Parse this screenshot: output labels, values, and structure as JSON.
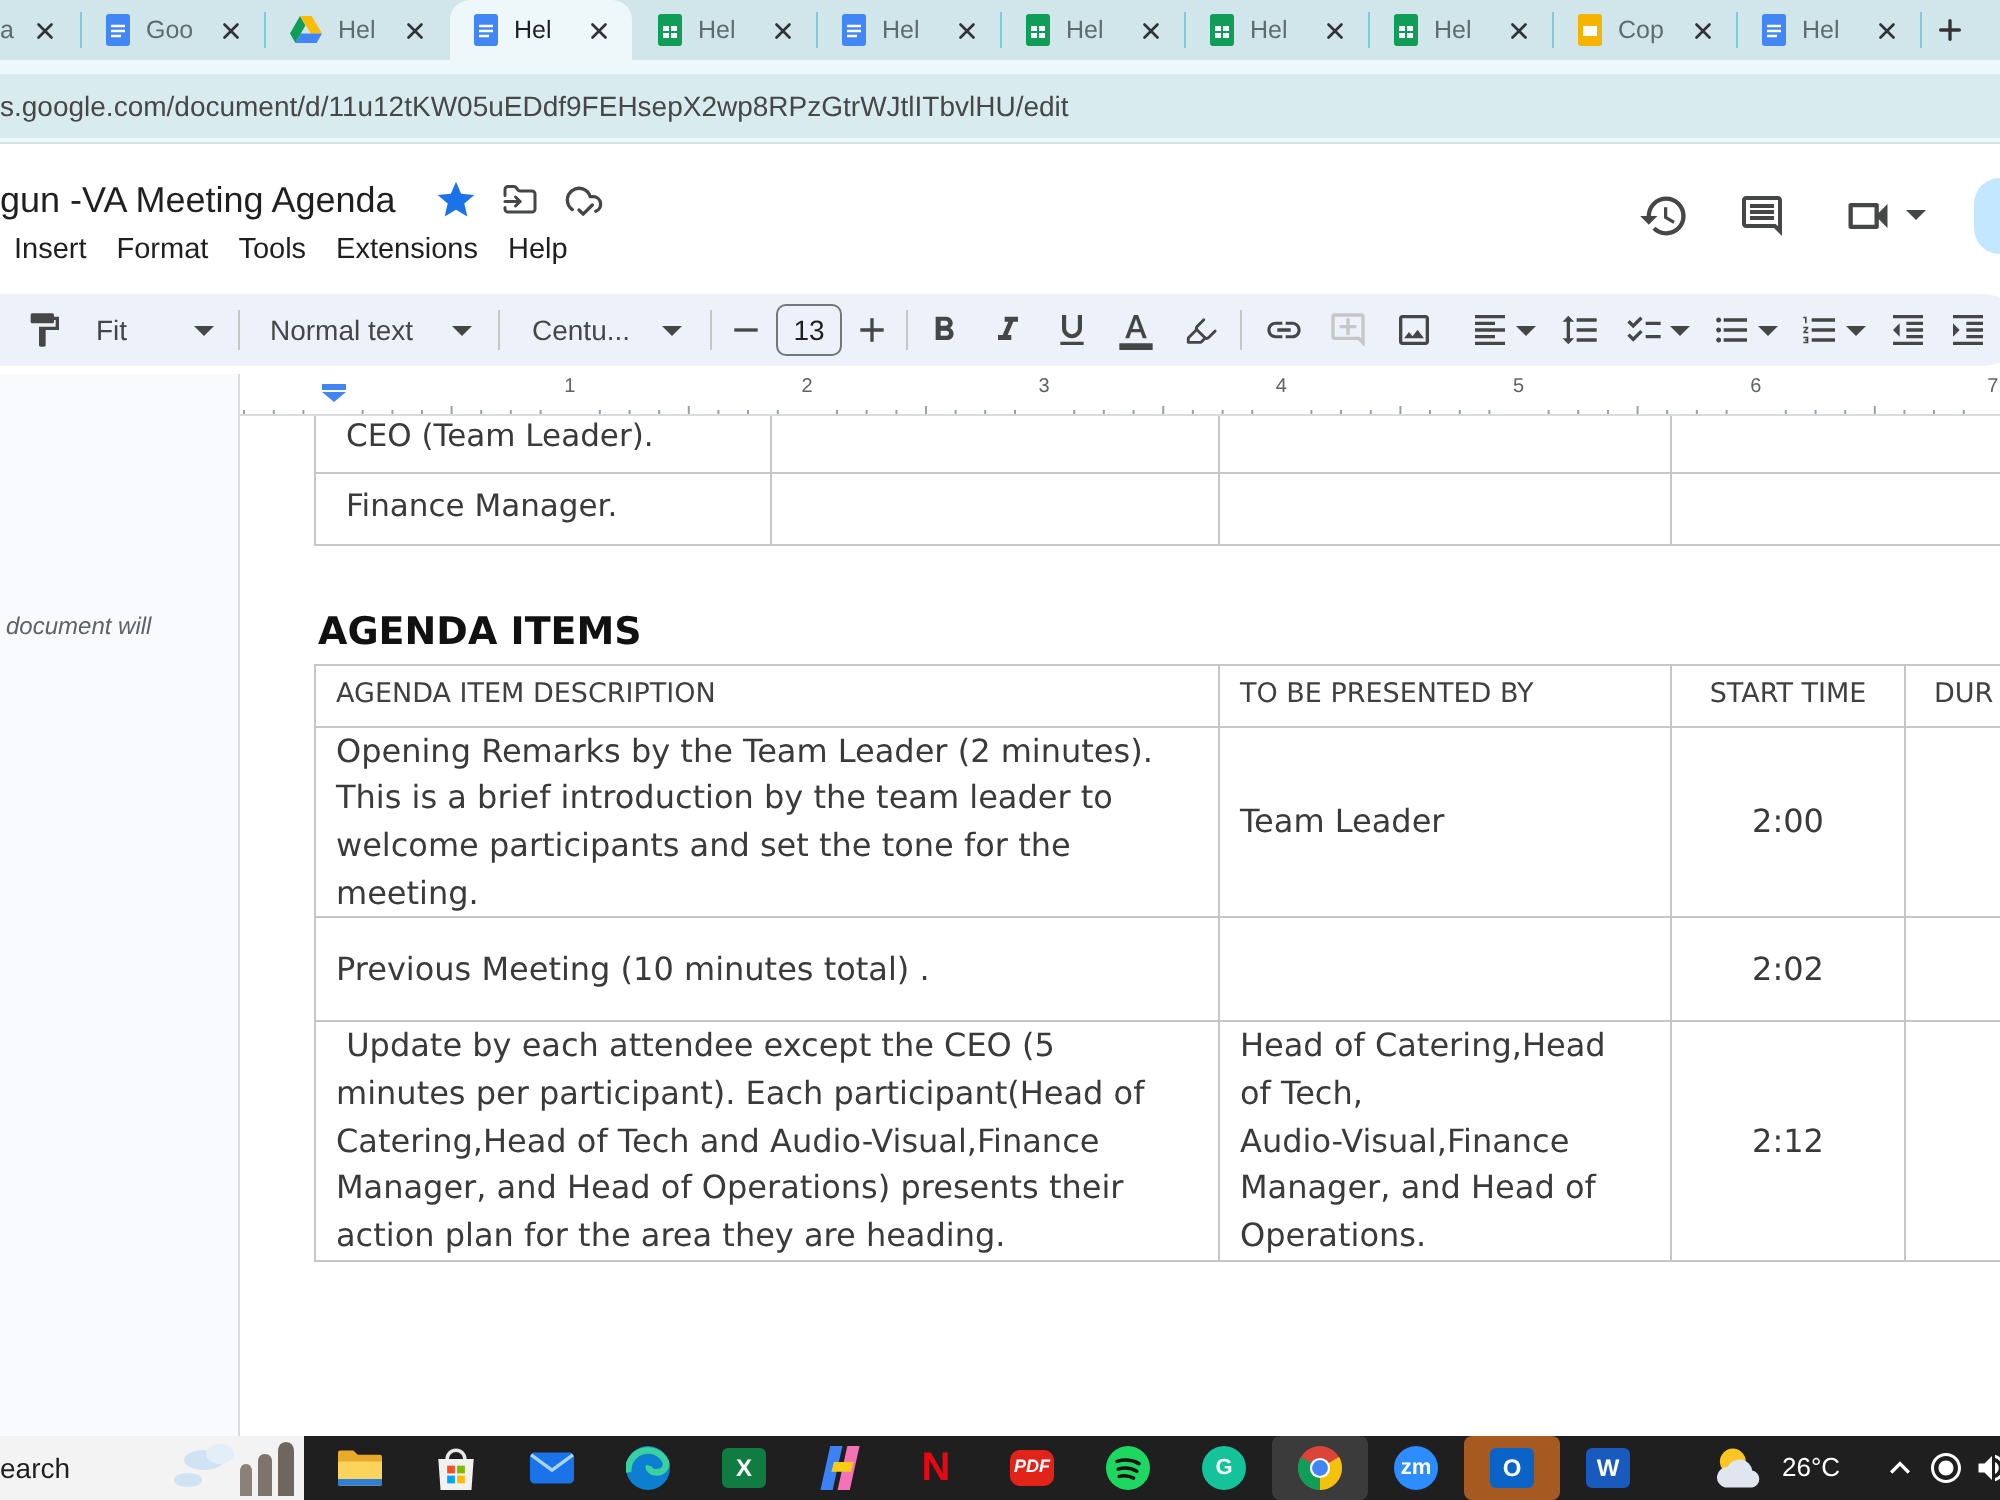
{
  "browser": {
    "tabs": [
      {
        "title": "a",
        "selected": false
      },
      {
        "kind": "docs",
        "title": "Goo",
        "selected": false
      },
      {
        "kind": "drive",
        "title": "Hel",
        "selected": false
      },
      {
        "kind": "docs",
        "title": "Hel",
        "selected": true
      },
      {
        "kind": "sheets",
        "title": "Hel",
        "selected": false
      },
      {
        "kind": "docs",
        "title": "Hel",
        "selected": false
      },
      {
        "kind": "sheets",
        "title": "Hel",
        "selected": false
      },
      {
        "kind": "sheets",
        "title": "Hel",
        "selected": false
      },
      {
        "kind": "sheets",
        "title": "Hel",
        "selected": false
      },
      {
        "kind": "slides",
        "title": "Cop",
        "selected": false
      },
      {
        "kind": "docs",
        "title": "Hel",
        "selected": false
      }
    ],
    "url": "s.google.com/document/d/11u12tKW05uEDdf9FEHsepX2wp8RPzGtrWJtlITbvlHU/edit"
  },
  "document_header": {
    "title": "gun -VA Meeting Agenda",
    "starred": true,
    "menu": [
      "Insert",
      "Format",
      "Tools",
      "Extensions",
      "Help"
    ]
  },
  "toolbar": {
    "zoom": "Fit",
    "paragraph_style": "Normal text",
    "font": "Centu...",
    "font_size": "13",
    "add_comment": {
      "disabled": true
    }
  },
  "ruler": {
    "labels": [
      "1",
      "2",
      "3",
      "4",
      "5",
      "6",
      "7"
    ]
  },
  "side_panel": {
    "text": "document will"
  },
  "document": {
    "roster_table": {
      "rows": [
        {
          "cells": [
            "CEO (Team Leader)."
          ]
        },
        {
          "cells": [
            "Finance Manager."
          ]
        }
      ]
    },
    "heading": "AGENDA ITEMS",
    "agenda_table": {
      "columns": [
        "AGENDA ITEM DESCRIPTION",
        "TO BE PRESENTED BY",
        "START TIME",
        "DUR"
      ],
      "rows": [
        {
          "description": "Opening Remarks by the Team Leader (2 minutes). This is a brief introduction by the team leader to welcome participants and set the tone for the meeting.",
          "presenter": "Team Leader",
          "start_time": "2:00"
        },
        {
          "description": "Previous Meeting (10 minutes total) .",
          "start_time": "2:02"
        },
        {
          "description": " Update by each attendee except the CEO (5 minutes per participant). Each participant(Head of Catering,Head of Tech and Audio-Visual,Finance Manager, and Head of Operations) presents their action plan for the area they are heading.",
          "presenter": "Head of Catering,Head of Tech, Audio-Visual,Finance Manager, and Head of Operations.",
          "start_time": "2:12"
        }
      ]
    }
  },
  "taskbar": {
    "search": {
      "placeholder": "earch"
    },
    "apps": [
      {
        "kind": "files",
        "selected": false,
        "attention": false
      },
      {
        "kind": "store",
        "selected": false,
        "attention": false
      },
      {
        "kind": "mail",
        "selected": false,
        "attention": false
      },
      {
        "kind": "browser_swirl",
        "selected": false,
        "attention": false
      },
      {
        "kind": "letter_tile",
        "label": "X",
        "color": "#107c41",
        "selected": false,
        "attention": false
      },
      {
        "kind": "assistant",
        "selected": false,
        "attention": false
      },
      {
        "kind": "letter_plain",
        "label": "N",
        "color": "#e50914",
        "selected": false,
        "attention": false
      },
      {
        "kind": "letter_badge",
        "label": "PDF",
        "color": "#e2231a",
        "selected": false,
        "attention": false
      },
      {
        "kind": "music",
        "selected": false,
        "attention": false
      },
      {
        "kind": "letter_round",
        "label": "G",
        "color": "#15c39a",
        "selected": false,
        "attention": false
      },
      {
        "kind": "browser_ball",
        "selected": true,
        "attention": false
      },
      {
        "kind": "letter_round",
        "label": "zm",
        "color": "#2d8cff",
        "selected": false,
        "attention": false
      },
      {
        "kind": "letter_tile",
        "label": "O",
        "color": "#0a64c8",
        "selected": false,
        "attention": true
      },
      {
        "kind": "letter_tile",
        "label": "W",
        "color": "#185abd",
        "selected": false,
        "attention": false
      }
    ],
    "weather": "26°C"
  }
}
